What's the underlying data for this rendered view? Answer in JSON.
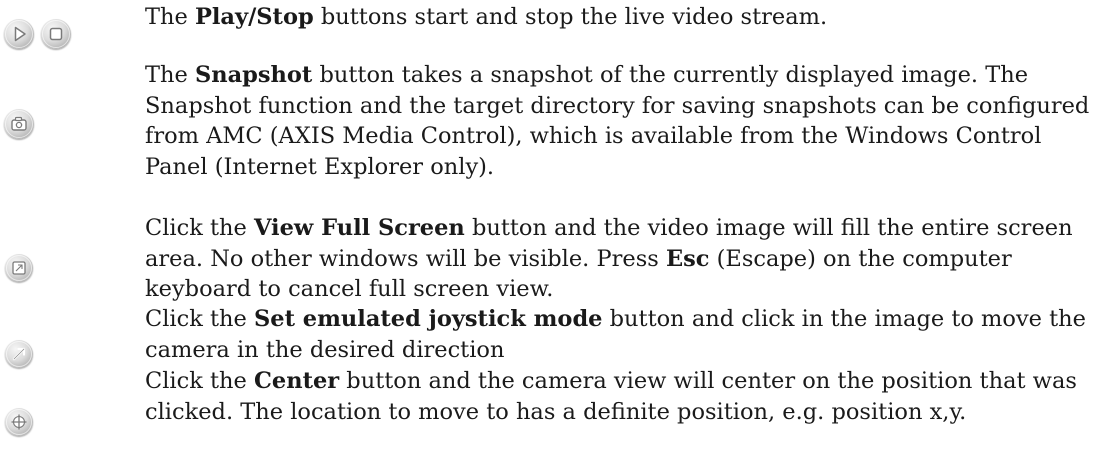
{
  "rows": [
    {
      "icons": [
        "play-icon",
        "stop-icon"
      ],
      "lead": "The ",
      "bold1": "Play/Stop",
      "text1": " buttons start and stop the live video stream."
    },
    {
      "icons": [
        "snapshot-icon"
      ],
      "lead": "The ",
      "bold1": "Snapshot",
      "text1": " button takes a snapshot of the currently displayed image. The Snapshot function and the target directory for saving snapshots can be configured from AMC (AXIS Media Control), which is available from the Windows Control Panel (Internet Explorer only)."
    },
    {
      "icons": [
        "full-screen-icon"
      ],
      "lead": "Click the ",
      "bold1": "View Full Screen",
      "text1": " button and the video image will fill the entire screen area. No other windows will be visible. Press ",
      "bold2": "Esc",
      "text2": " (Escape) on the computer keyboard to cancel full screen view."
    },
    {
      "icons": [
        "joystick-icon"
      ],
      "lead": "Click the ",
      "bold1": "Set emulated joystick mode",
      "text1": " button and click in the image to move the camera in the desired direction"
    },
    {
      "icons": [
        "center-icon"
      ],
      "lead": "Click the ",
      "bold1": "Center",
      "text1": " button and the camera view will center on the position that was clicked. The location to move to has a definite position, e.g. position x,y."
    }
  ]
}
